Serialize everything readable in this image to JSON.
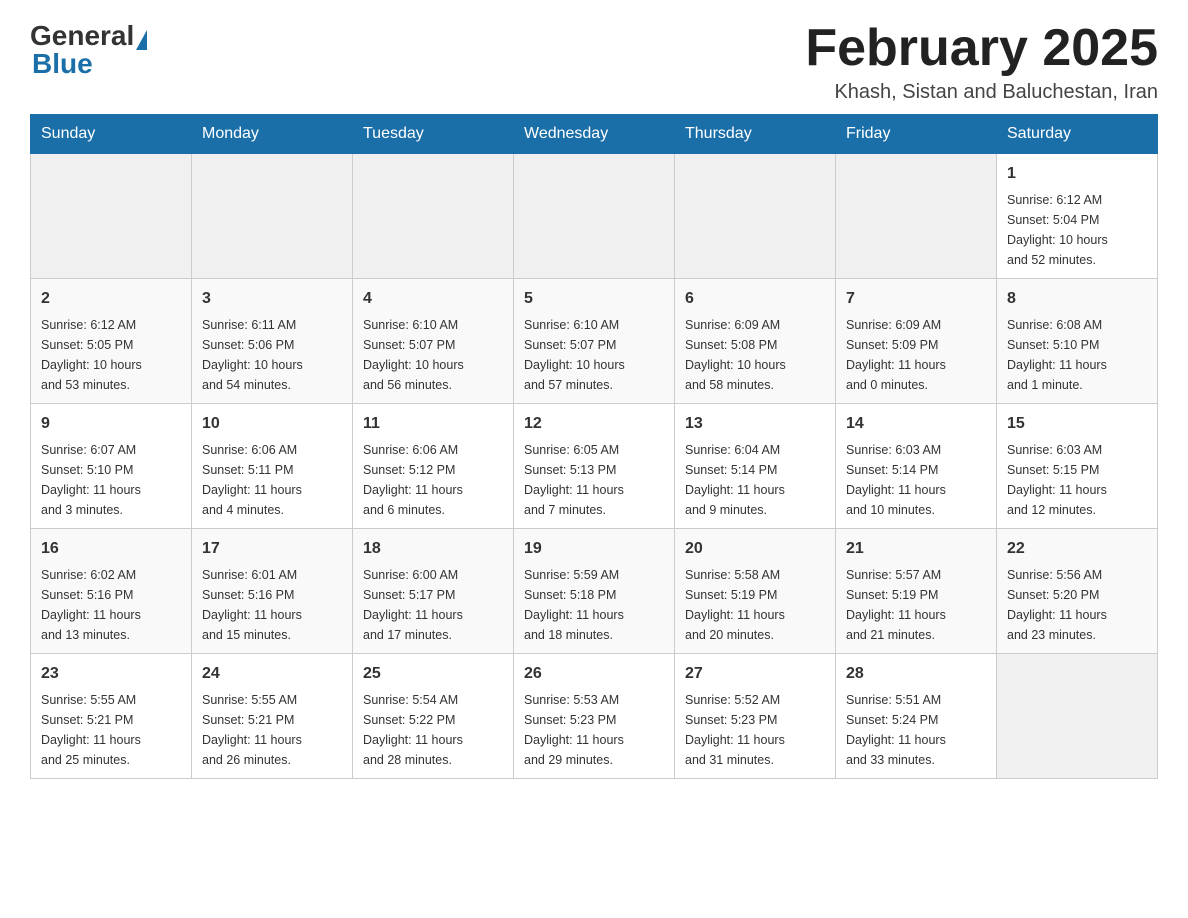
{
  "header": {
    "logo": {
      "part1": "General",
      "part2": "Blue"
    },
    "title": "February 2025",
    "location": "Khash, Sistan and Baluchestan, Iran"
  },
  "weekdays": [
    "Sunday",
    "Monday",
    "Tuesday",
    "Wednesday",
    "Thursday",
    "Friday",
    "Saturday"
  ],
  "weeks": [
    {
      "days": [
        {
          "date": "",
          "info": ""
        },
        {
          "date": "",
          "info": ""
        },
        {
          "date": "",
          "info": ""
        },
        {
          "date": "",
          "info": ""
        },
        {
          "date": "",
          "info": ""
        },
        {
          "date": "",
          "info": ""
        },
        {
          "date": "1",
          "info": "Sunrise: 6:12 AM\nSunset: 5:04 PM\nDaylight: 10 hours\nand 52 minutes."
        }
      ]
    },
    {
      "days": [
        {
          "date": "2",
          "info": "Sunrise: 6:12 AM\nSunset: 5:05 PM\nDaylight: 10 hours\nand 53 minutes."
        },
        {
          "date": "3",
          "info": "Sunrise: 6:11 AM\nSunset: 5:06 PM\nDaylight: 10 hours\nand 54 minutes."
        },
        {
          "date": "4",
          "info": "Sunrise: 6:10 AM\nSunset: 5:07 PM\nDaylight: 10 hours\nand 56 minutes."
        },
        {
          "date": "5",
          "info": "Sunrise: 6:10 AM\nSunset: 5:07 PM\nDaylight: 10 hours\nand 57 minutes."
        },
        {
          "date": "6",
          "info": "Sunrise: 6:09 AM\nSunset: 5:08 PM\nDaylight: 10 hours\nand 58 minutes."
        },
        {
          "date": "7",
          "info": "Sunrise: 6:09 AM\nSunset: 5:09 PM\nDaylight: 11 hours\nand 0 minutes."
        },
        {
          "date": "8",
          "info": "Sunrise: 6:08 AM\nSunset: 5:10 PM\nDaylight: 11 hours\nand 1 minute."
        }
      ]
    },
    {
      "days": [
        {
          "date": "9",
          "info": "Sunrise: 6:07 AM\nSunset: 5:10 PM\nDaylight: 11 hours\nand 3 minutes."
        },
        {
          "date": "10",
          "info": "Sunrise: 6:06 AM\nSunset: 5:11 PM\nDaylight: 11 hours\nand 4 minutes."
        },
        {
          "date": "11",
          "info": "Sunrise: 6:06 AM\nSunset: 5:12 PM\nDaylight: 11 hours\nand 6 minutes."
        },
        {
          "date": "12",
          "info": "Sunrise: 6:05 AM\nSunset: 5:13 PM\nDaylight: 11 hours\nand 7 minutes."
        },
        {
          "date": "13",
          "info": "Sunrise: 6:04 AM\nSunset: 5:14 PM\nDaylight: 11 hours\nand 9 minutes."
        },
        {
          "date": "14",
          "info": "Sunrise: 6:03 AM\nSunset: 5:14 PM\nDaylight: 11 hours\nand 10 minutes."
        },
        {
          "date": "15",
          "info": "Sunrise: 6:03 AM\nSunset: 5:15 PM\nDaylight: 11 hours\nand 12 minutes."
        }
      ]
    },
    {
      "days": [
        {
          "date": "16",
          "info": "Sunrise: 6:02 AM\nSunset: 5:16 PM\nDaylight: 11 hours\nand 13 minutes."
        },
        {
          "date": "17",
          "info": "Sunrise: 6:01 AM\nSunset: 5:16 PM\nDaylight: 11 hours\nand 15 minutes."
        },
        {
          "date": "18",
          "info": "Sunrise: 6:00 AM\nSunset: 5:17 PM\nDaylight: 11 hours\nand 17 minutes."
        },
        {
          "date": "19",
          "info": "Sunrise: 5:59 AM\nSunset: 5:18 PM\nDaylight: 11 hours\nand 18 minutes."
        },
        {
          "date": "20",
          "info": "Sunrise: 5:58 AM\nSunset: 5:19 PM\nDaylight: 11 hours\nand 20 minutes."
        },
        {
          "date": "21",
          "info": "Sunrise: 5:57 AM\nSunset: 5:19 PM\nDaylight: 11 hours\nand 21 minutes."
        },
        {
          "date": "22",
          "info": "Sunrise: 5:56 AM\nSunset: 5:20 PM\nDaylight: 11 hours\nand 23 minutes."
        }
      ]
    },
    {
      "days": [
        {
          "date": "23",
          "info": "Sunrise: 5:55 AM\nSunset: 5:21 PM\nDaylight: 11 hours\nand 25 minutes."
        },
        {
          "date": "24",
          "info": "Sunrise: 5:55 AM\nSunset: 5:21 PM\nDaylight: 11 hours\nand 26 minutes."
        },
        {
          "date": "25",
          "info": "Sunrise: 5:54 AM\nSunset: 5:22 PM\nDaylight: 11 hours\nand 28 minutes."
        },
        {
          "date": "26",
          "info": "Sunrise: 5:53 AM\nSunset: 5:23 PM\nDaylight: 11 hours\nand 29 minutes."
        },
        {
          "date": "27",
          "info": "Sunrise: 5:52 AM\nSunset: 5:23 PM\nDaylight: 11 hours\nand 31 minutes."
        },
        {
          "date": "28",
          "info": "Sunrise: 5:51 AM\nSunset: 5:24 PM\nDaylight: 11 hours\nand 33 minutes."
        },
        {
          "date": "",
          "info": ""
        }
      ]
    }
  ]
}
